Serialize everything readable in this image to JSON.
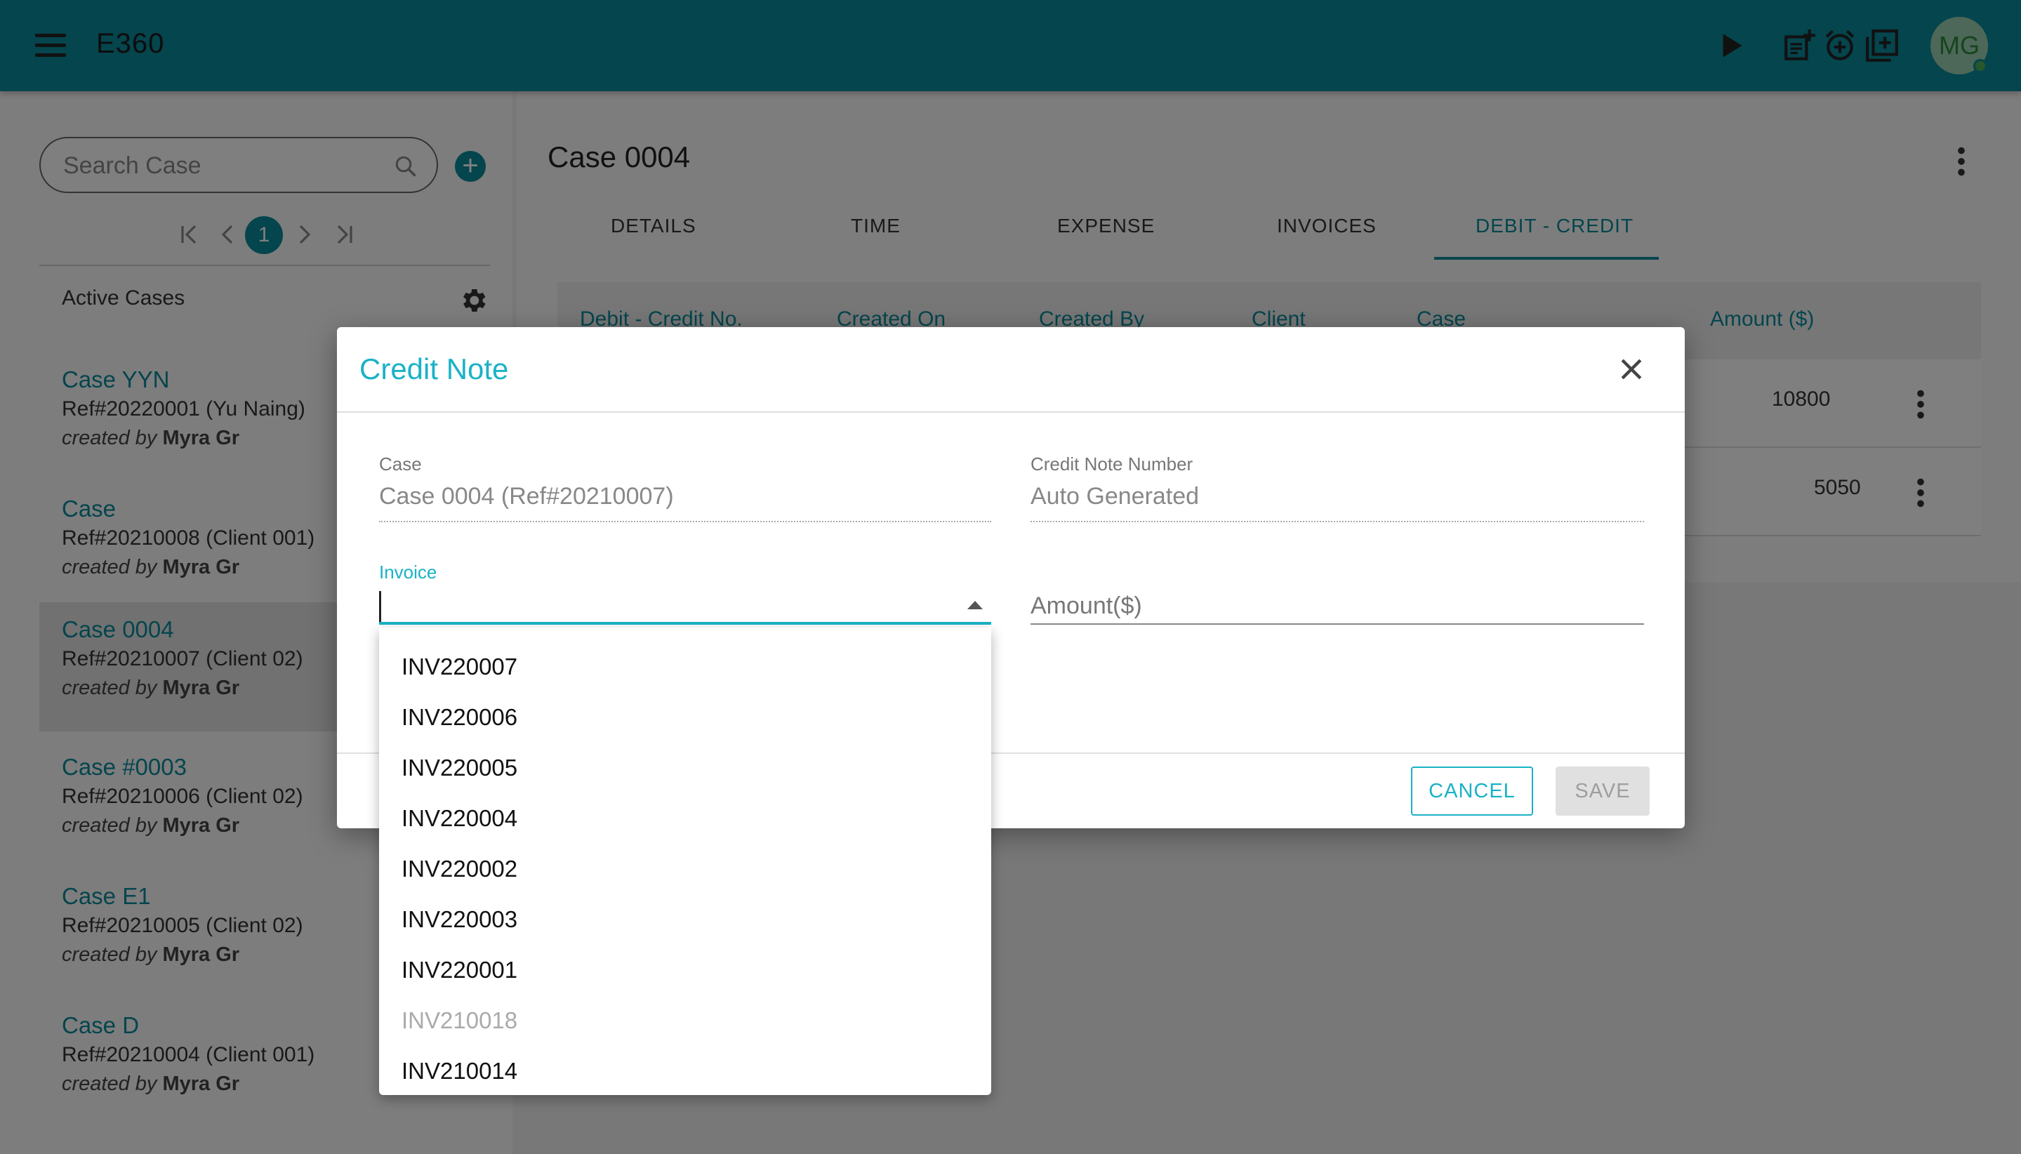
{
  "app": {
    "title": "E360",
    "avatar_initials": "MG"
  },
  "sidebar": {
    "search_placeholder": "Search Case",
    "add_label": "+",
    "pager": {
      "first": "|<",
      "prev": "<",
      "current": "1",
      "next": ">",
      "last": ">|"
    },
    "active_cases_title": "Active Cases",
    "cases": [
      {
        "name": "Case YYN",
        "ref": "Ref#20220001 (Yu Naing)",
        "created_prefix": "created by",
        "created_by": "Myra Gr"
      },
      {
        "name": "Case",
        "ref": "Ref#20210008 (Client 001)",
        "created_prefix": "created by",
        "created_by": "Myra Gr"
      },
      {
        "name": "Case 0004",
        "ref": "Ref#20210007 (Client 02)",
        "created_prefix": "created by",
        "created_by": "Myra Gr"
      },
      {
        "name": "Case #0003",
        "ref": "Ref#20210006 (Client 02)",
        "created_prefix": "created by",
        "created_by": "Myra Gr"
      },
      {
        "name": "Case E1",
        "ref": "Ref#20210005 (Client 02)",
        "created_prefix": "created by",
        "created_by": "Myra Gr"
      },
      {
        "name": "Case D",
        "ref": "Ref#20210004 (Client 001)",
        "created_prefix": "created by",
        "created_by": "Myra Gr"
      }
    ]
  },
  "main": {
    "case_title": "Case 0004",
    "tabs": [
      "DETAILS",
      "TIME",
      "EXPENSE",
      "INVOICES",
      "DEBIT - CREDIT"
    ],
    "grid_headers": [
      "Debit - Credit No.",
      "Created On",
      "Created By",
      "Client",
      "Case",
      "Amount ($)"
    ],
    "rows": [
      {
        "amount": "10800"
      },
      {
        "amount": "5050"
      }
    ]
  },
  "dialog": {
    "title": "Credit Note",
    "case_label": "Case",
    "case_value": "Case 0004 (Ref#20210007)",
    "credit_note_label": "Credit Note Number",
    "credit_note_value": "Auto Generated",
    "invoice_label": "Invoice",
    "invoice_value": "",
    "amount_placeholder": "Amount($)",
    "cancel_label": "CANCEL",
    "save_label": "SAVE"
  },
  "invoice_options": [
    {
      "label": "INV220007",
      "disabled": false
    },
    {
      "label": "INV220006",
      "disabled": false
    },
    {
      "label": "INV220005",
      "disabled": false
    },
    {
      "label": "INV220004",
      "disabled": false
    },
    {
      "label": "INV220002",
      "disabled": false
    },
    {
      "label": "INV220003",
      "disabled": false
    },
    {
      "label": "INV220001",
      "disabled": false
    },
    {
      "label": "INV210018",
      "disabled": true
    },
    {
      "label": "INV210014",
      "disabled": false
    }
  ],
  "colors": {
    "primary": "#0b8a9b",
    "accent": "#1ab2c6",
    "topbar": "#0b8a9b"
  }
}
